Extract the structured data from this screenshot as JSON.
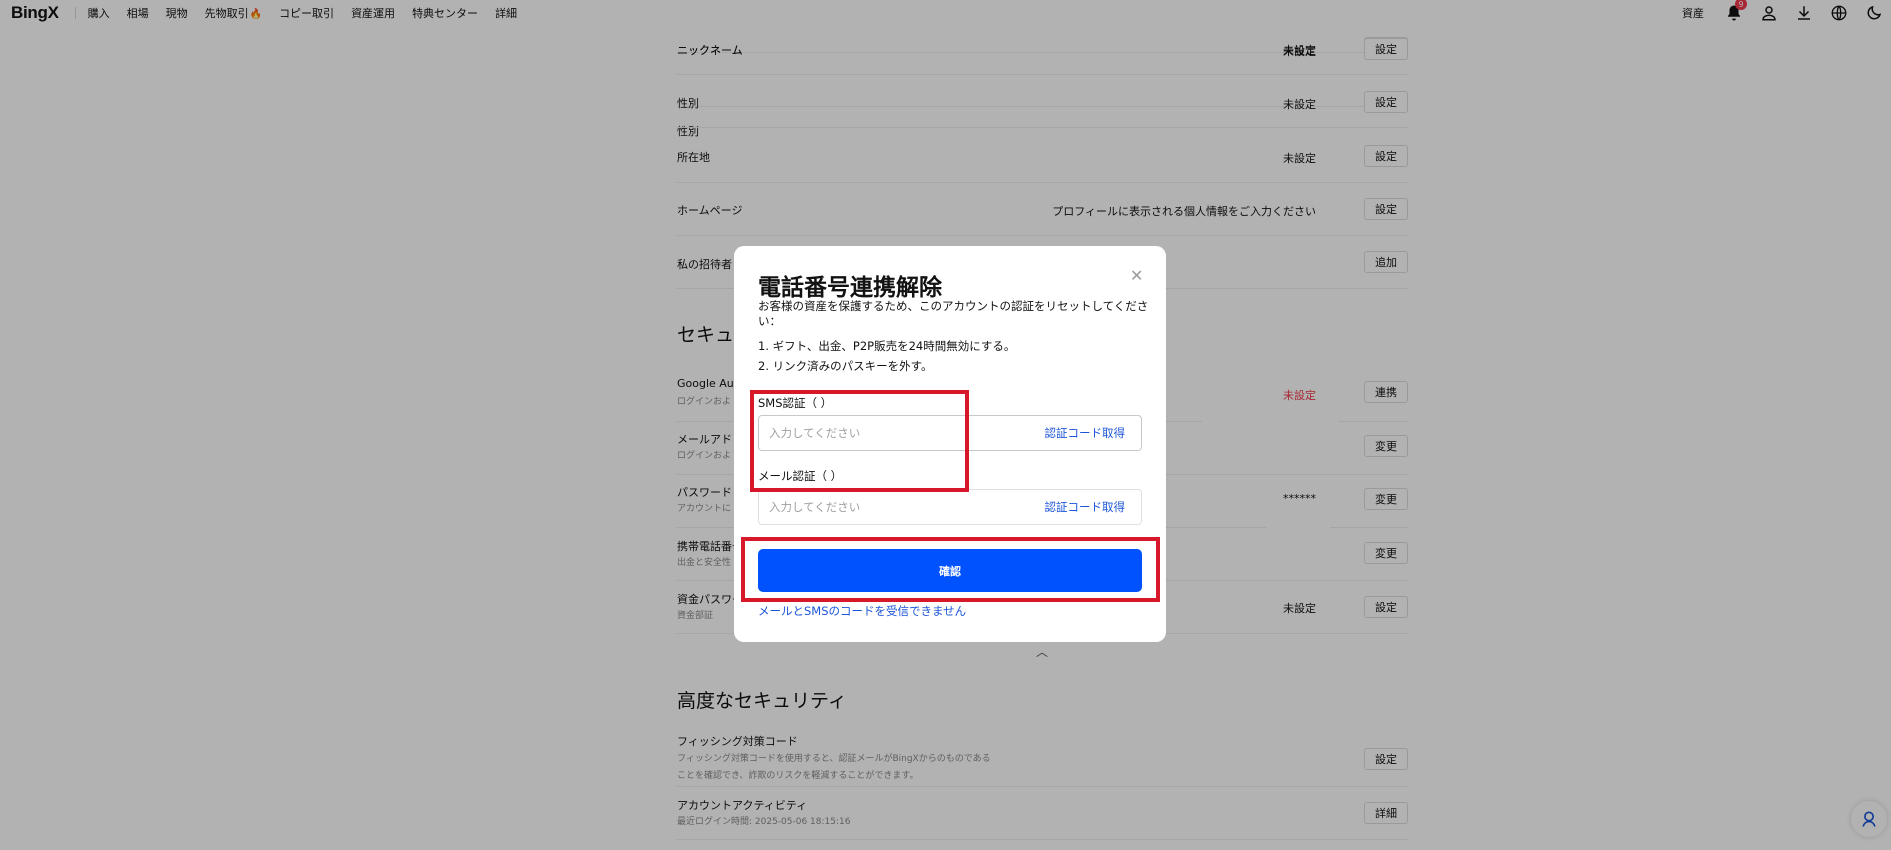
{
  "nav": {
    "logo": "BingX",
    "items": [
      "購入",
      "相場",
      "現物",
      "先物取引",
      "コピー取引",
      "資産運用",
      "特典センター",
      "詳細"
    ],
    "hot_icon": "fire-icon",
    "assets_label": "資産",
    "notification_count": "9",
    "icons": [
      "bell-icon",
      "user-icon",
      "download-icon",
      "globe-icon",
      "moon-icon"
    ]
  },
  "profile_rows": [
    {
      "title": "ニックネーム",
      "value": "未設定",
      "button": "設定"
    },
    {
      "title": "性別",
      "value": "未設定",
      "button": "設定"
    },
    {
      "title": "所在地",
      "value": "未設定",
      "button": "設定"
    },
    {
      "title": "ホームページ",
      "value": "プロフィールに表示される個人情報をご入力ください",
      "button": "設定"
    },
    {
      "title": "私の招待者",
      "value": "",
      "button": "追加"
    }
  ],
  "security": {
    "title": "セキュ",
    "rows": [
      {
        "title": "Google Aut",
        "subtitle": "ログインおよ",
        "value": "未設定",
        "button": "連携"
      },
      {
        "title": "メールアドレ",
        "subtitle": "ログインおよ",
        "value": "",
        "button": "変更"
      },
      {
        "title": "パスワード",
        "subtitle": "アカウントに",
        "value": "******",
        "button": "変更"
      },
      {
        "title": "携帯電話番号",
        "subtitle": "出金と安全性",
        "value": "",
        "button": "変更"
      },
      {
        "title": "資金パスワー",
        "subtitle": "資金部証",
        "value": "未設定",
        "button": "設定"
      }
    ]
  },
  "advanced": {
    "title": "高度なセキュリティ",
    "rows": [
      {
        "title": "フィッシング対策コード",
        "subtitle": "フィッシング対策コードを使用すると、認証メールがBingXからのものである",
        "subtitle2": "ことを確認でき、詐欺のリスクを軽減することができます。",
        "button": "設定"
      },
      {
        "title": "アカウントアクティビティ",
        "subtitle": "最近ログイン時間: 2025-05-06 18:15:16",
        "button": "詳細"
      }
    ]
  },
  "modal": {
    "title": "電話番号連携解除",
    "description": "お客様の資産を保護するため、このアカウントの認証をリセットしてください：",
    "list": [
      "1. ギフト、出金、P2P販売を24時間無効にする。",
      "2. リンク済みのパスキーを外す。"
    ],
    "sms_label": "SMS認証（                 ）",
    "sms_placeholder": "入力してください",
    "sms_get_code": "認証コード取得",
    "email_label": "メール認証（                         ）",
    "email_placeholder": "入力してください",
    "email_get_code": "認証コード取得",
    "confirm": "確認",
    "no_code_link": "メールとSMSのコードを受信できません",
    "close_icon": "close-icon"
  },
  "colors": {
    "accent": "#0052ff",
    "link": "#1b55d8",
    "warning": "#f0394b",
    "highlight": "#d7182a"
  }
}
